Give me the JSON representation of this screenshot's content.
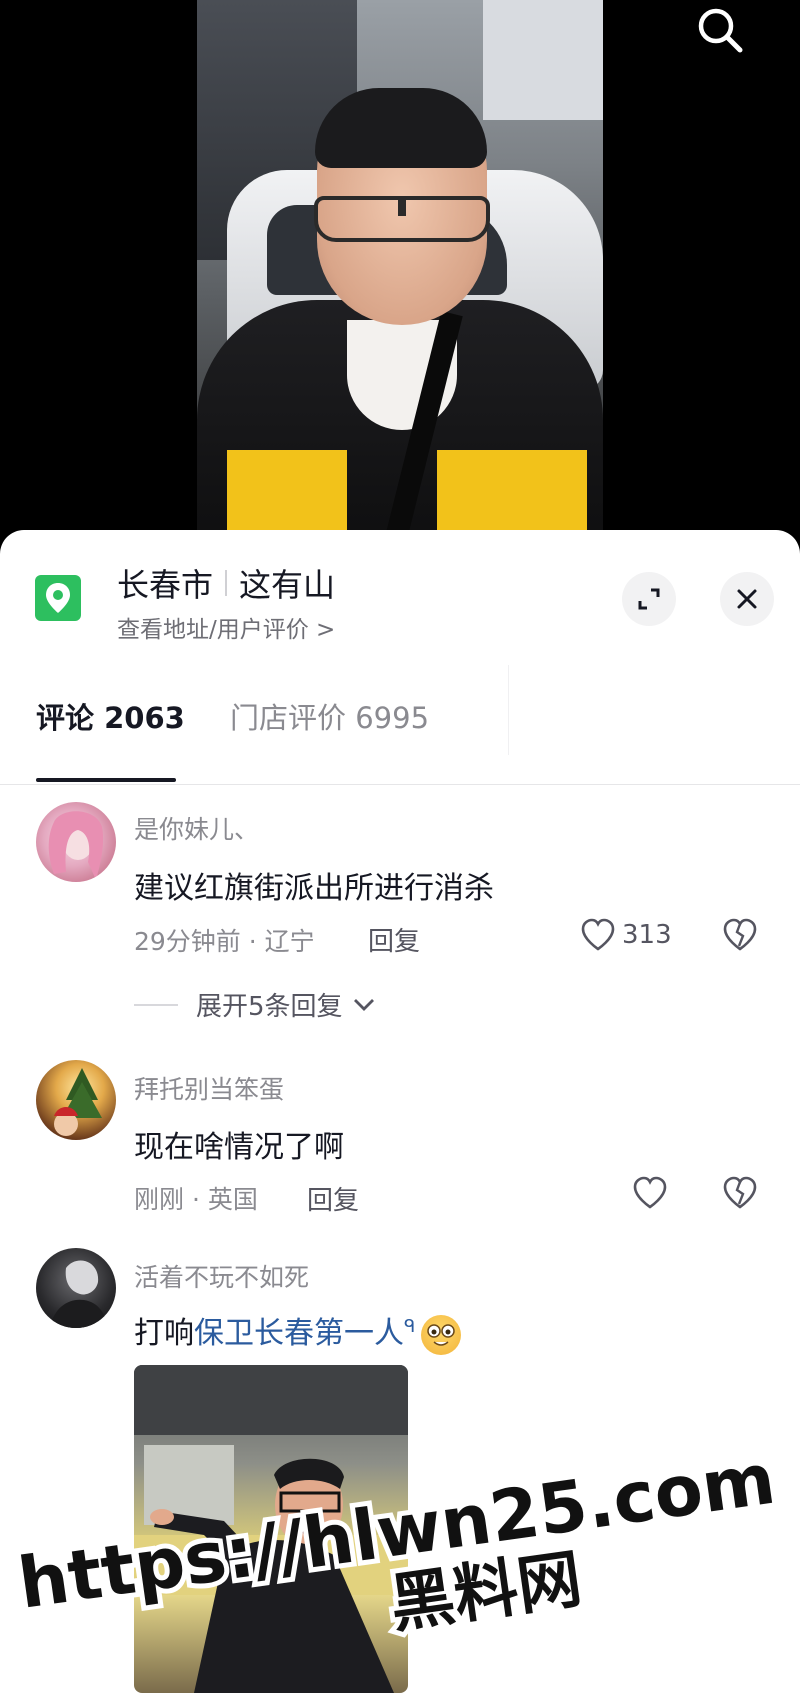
{
  "location": {
    "city": "长春市",
    "place": "这有山",
    "subtitle": "查看地址/用户评价 >"
  },
  "tabs": [
    {
      "label": "评论 2063",
      "active": true
    },
    {
      "label": "门店评价 6995",
      "active": false
    }
  ],
  "comments": [
    {
      "username": "是你妹儿、",
      "text": "建议红旗街派出所进行消杀",
      "meta": "29分钟前 · 辽宁",
      "reply_label": "回复",
      "likes": "313",
      "expand_label": "展开5条回复"
    },
    {
      "username": "拜托别当笨蛋",
      "text": "现在啥情况了啊",
      "meta": "刚刚 · 英国",
      "reply_label": "回复"
    },
    {
      "username": "活着不玩不如死",
      "text_prefix": "打响",
      "text_link": "保卫长春第一人",
      "search_glyph": "ᑫ",
      "emoji": "emoji-face"
    }
  ],
  "watermark": {
    "url": "https://hlwn25.com",
    "name": "黑料网"
  },
  "colors": {
    "accent_green": "#2dbf5f",
    "link_blue": "#2b5b9e",
    "text_primary": "#161823",
    "text_secondary": "#8a8a90"
  },
  "icons": [
    "search-icon",
    "location-pin-icon",
    "expand-icon",
    "close-icon",
    "heart-icon",
    "broken-heart-icon",
    "chevron-down-icon",
    "emoji-face-icon"
  ]
}
